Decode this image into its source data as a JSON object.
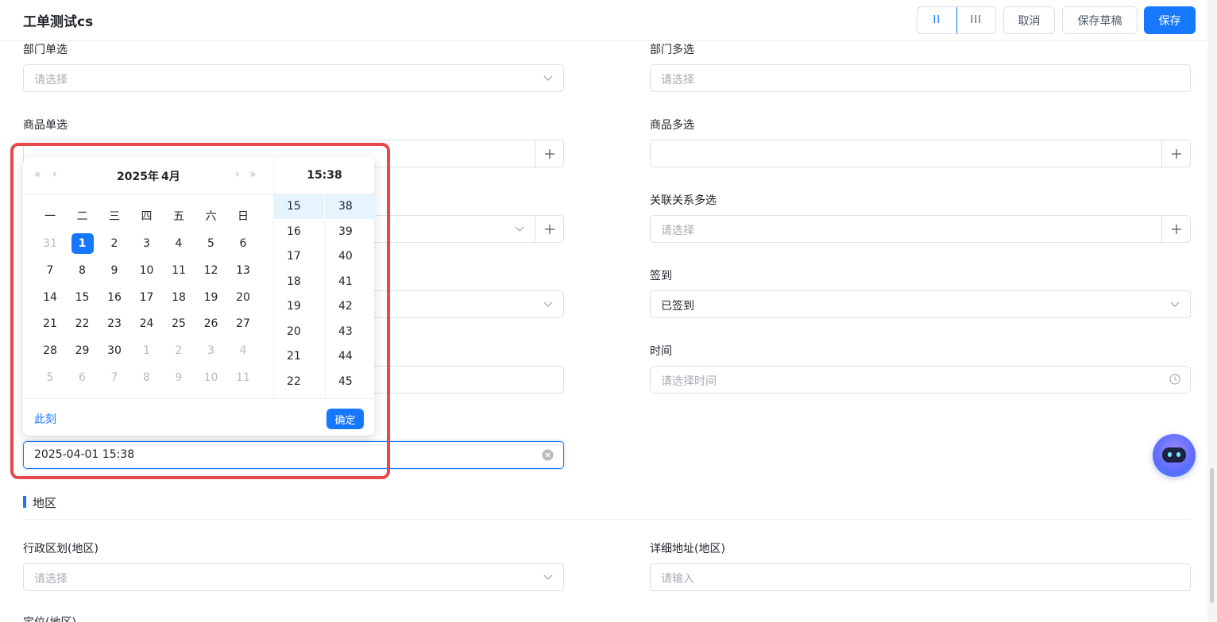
{
  "header": {
    "title": "工单测试cs",
    "layout_two_label": "II",
    "layout_three_label": "III",
    "cancel_label": "取消",
    "draft_label": "保存草稿",
    "save_label": "保存"
  },
  "fields": {
    "dept_single": {
      "label": "部门单选",
      "placeholder": "请选择"
    },
    "dept_multi": {
      "label": "部门多选",
      "placeholder": "请选择"
    },
    "product_single": {
      "label": "商品单选"
    },
    "product_multi": {
      "label": "商品多选"
    },
    "relation_multi": {
      "label": "关联关系多选",
      "placeholder": "请选择"
    },
    "checkin": {
      "label": "签到",
      "value": "已签到"
    },
    "time": {
      "label": "时间",
      "placeholder": "请选择时间"
    },
    "datetime": {
      "value": "2025-04-01 15:38"
    },
    "region_admin": {
      "label": "行政区划(地区)",
      "placeholder": "请选择"
    },
    "region_address": {
      "label": "详细地址(地区)",
      "placeholder": "请输入"
    },
    "location_partial": {
      "label": "定位(地区)"
    }
  },
  "section": {
    "title": "地区"
  },
  "picker": {
    "year_label": "2025年",
    "month_label": "4月",
    "time_header": "15:38",
    "weekdays": [
      "一",
      "二",
      "三",
      "四",
      "五",
      "六",
      "日"
    ],
    "weeks": [
      [
        "31",
        "1",
        "2",
        "3",
        "4",
        "5",
        "6"
      ],
      [
        "7",
        "8",
        "9",
        "10",
        "11",
        "12",
        "13"
      ],
      [
        "14",
        "15",
        "16",
        "17",
        "18",
        "19",
        "20"
      ],
      [
        "21",
        "22",
        "23",
        "24",
        "25",
        "26",
        "27"
      ],
      [
        "28",
        "29",
        "30",
        "1",
        "2",
        "3",
        "4"
      ],
      [
        "5",
        "6",
        "7",
        "8",
        "9",
        "10",
        "11"
      ]
    ],
    "selected_day": "1",
    "hours": [
      "15",
      "16",
      "17",
      "18",
      "19",
      "20",
      "21",
      "22"
    ],
    "minutes": [
      "38",
      "39",
      "40",
      "41",
      "42",
      "43",
      "44",
      "45"
    ],
    "now_label": "此刻",
    "ok_label": "确定"
  },
  "colors": {
    "primary": "#1677ff",
    "highlight": "#e5484d"
  }
}
